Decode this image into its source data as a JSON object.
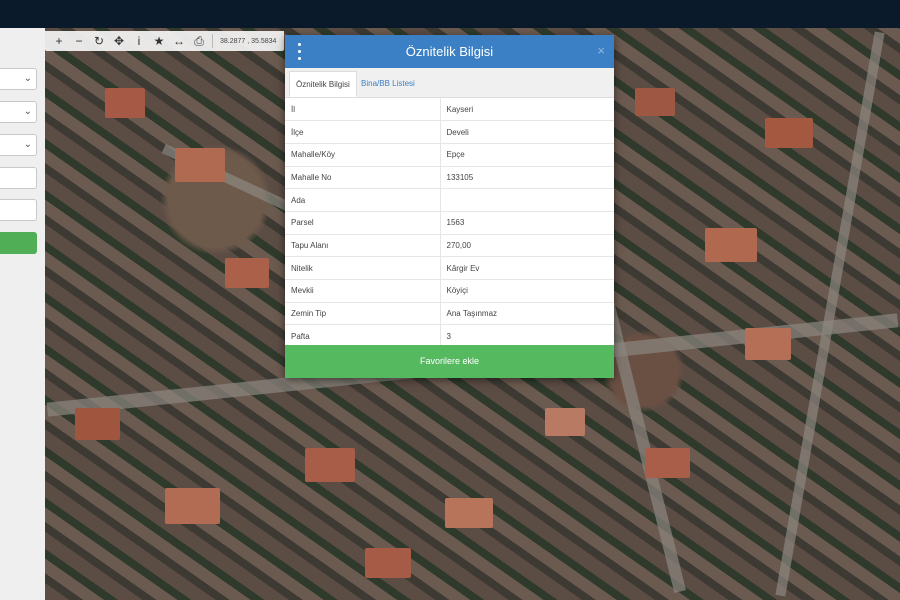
{
  "toolbar": {
    "buttons": [
      {
        "icon": "zoom-in-icon",
        "glyph": "+"
      },
      {
        "icon": "zoom-out-icon",
        "glyph": "−"
      },
      {
        "icon": "refresh-icon",
        "glyph": "↻"
      },
      {
        "icon": "locate-icon",
        "glyph": "✥"
      },
      {
        "icon": "info-icon",
        "glyph": "i"
      },
      {
        "icon": "star-icon",
        "glyph": "★"
      },
      {
        "icon": "measure-icon",
        "glyph": "↔"
      },
      {
        "icon": "print-icon",
        "glyph": "⎙"
      }
    ],
    "coordinates": "38.2877 , 35.5834"
  },
  "panel": {
    "title": "Öznitelik Bilgisi",
    "close_glyph": "×",
    "tabs": [
      {
        "label": "Öznitelik Bilgisi",
        "active": true
      },
      {
        "label": "Bina/BB Listesi",
        "active": false
      }
    ],
    "rows": [
      {
        "key": "İl",
        "value": "Kayseri"
      },
      {
        "key": "İlçe",
        "value": "Develi"
      },
      {
        "key": "Mahalle/Köy",
        "value": "Epçe"
      },
      {
        "key": "Mahalle No",
        "value": "133105"
      },
      {
        "key": "Ada",
        "value": ""
      },
      {
        "key": "Parsel",
        "value": "1563"
      },
      {
        "key": "Tapu Alanı",
        "value": "270,00"
      },
      {
        "key": "Nitelik",
        "value": "Kârgir Ev"
      },
      {
        "key": "Mevkii",
        "value": "Köyiçi"
      },
      {
        "key": "Zemin Tip",
        "value": "Ana Taşınmaz"
      },
      {
        "key": "Pafta",
        "value": "3"
      }
    ],
    "favorite_button": "Favorilere ekle"
  },
  "colors": {
    "header": "#3b80c4",
    "favorite": "#55b960",
    "topbar": "#0b1a2a"
  }
}
